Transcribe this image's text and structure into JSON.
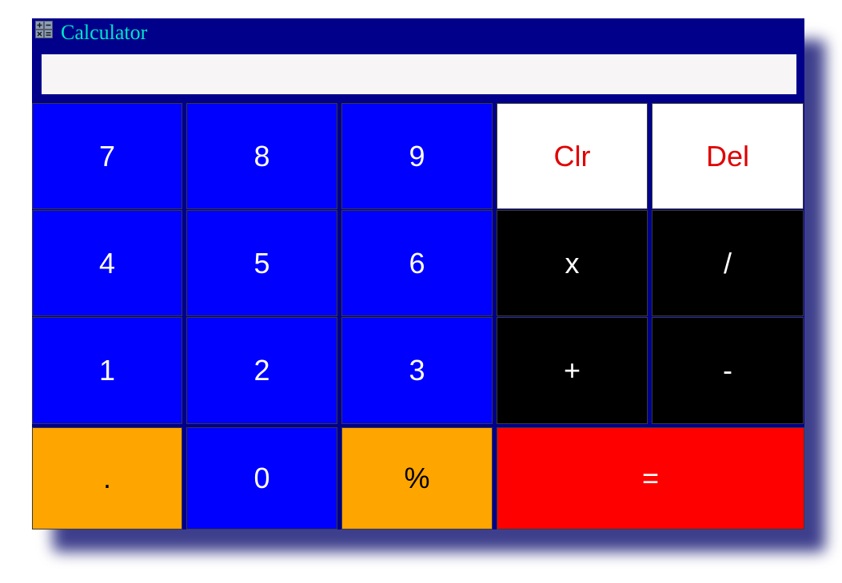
{
  "window": {
    "title": "Calculator",
    "icon": "calculator-icon",
    "background_color": "#00008b",
    "title_color": "#00e5c8"
  },
  "display": {
    "value": "",
    "placeholder": ""
  },
  "keys": {
    "seven": "7",
    "eight": "8",
    "nine": "9",
    "clear": "Clr",
    "delete": "Del",
    "four": "4",
    "five": "5",
    "six": "6",
    "multiply": "x",
    "divide": "/",
    "one": "1",
    "two": "2",
    "three": "3",
    "add": "+",
    "subtract": "-",
    "decimal": ".",
    "zero": "0",
    "percent": "%",
    "equals": "="
  },
  "colors": {
    "number_key": "#0000fe",
    "function_key": "#ffffff",
    "function_text": "#e00000",
    "operator_key": "#000000",
    "misc_key": "#ffa500",
    "equals_key": "#fe0000"
  }
}
